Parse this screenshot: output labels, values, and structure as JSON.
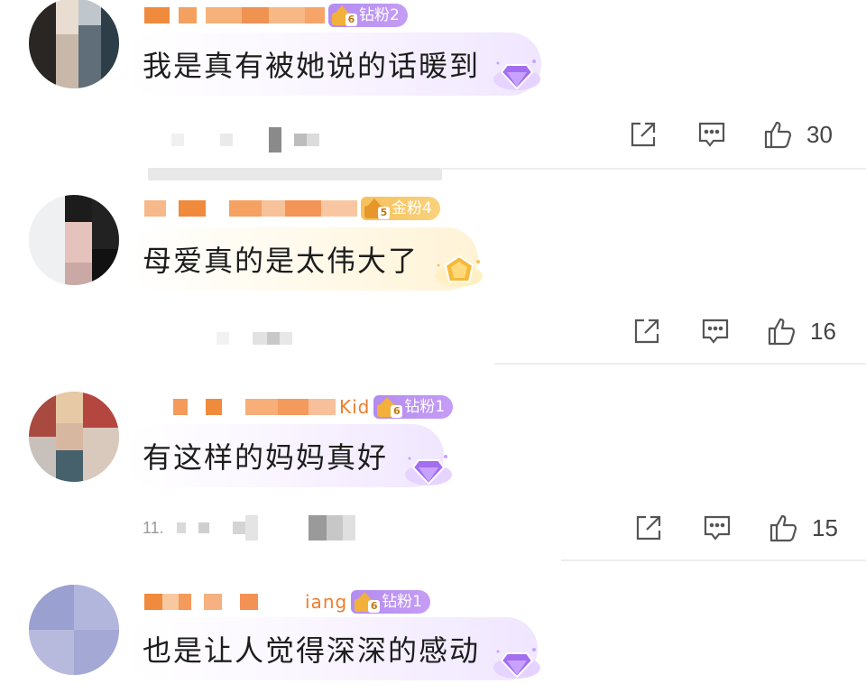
{
  "comments": [
    {
      "name_visible": "",
      "badge": {
        "level": "6",
        "label": "钻粉2",
        "tier": "diamond"
      },
      "text": "我是真有被她说的话暖到",
      "meta_time": "",
      "likes": "30"
    },
    {
      "name_visible": "",
      "badge": {
        "level": "5",
        "label": "金粉4",
        "tier": "gold"
      },
      "text": "母爱真的是太伟大了",
      "meta_time": "",
      "likes": "16"
    },
    {
      "name_visible": "Kid",
      "badge": {
        "level": "6",
        "label": "钻粉1",
        "tier": "diamond"
      },
      "text": "有这样的妈妈真好",
      "meta_time": "11.",
      "likes": "15"
    },
    {
      "name_visible": "iang",
      "badge": {
        "level": "6",
        "label": "钻粉1",
        "tier": "diamond"
      },
      "text": "也是让人觉得深深的感动",
      "meta_time": "",
      "likes": ""
    }
  ],
  "icons": {
    "share": "share-icon",
    "reply": "comment-icon",
    "like": "thumbs-up-icon"
  },
  "colors": {
    "name_orange": "#ef7d2b",
    "diamond_badge": "#b48cf0",
    "gold_badge": "#f6c05a",
    "divider": "#ededed"
  }
}
